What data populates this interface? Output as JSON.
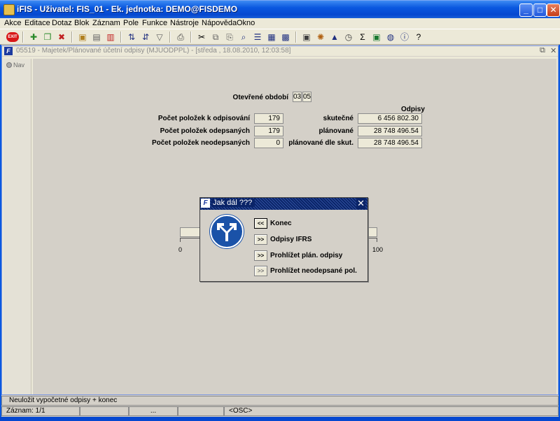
{
  "window": {
    "title": "iFIS - Uživatel: FIS_01 - Ek. jednotka: DEMO@FISDEMO"
  },
  "menu": [
    "Akce",
    "Editace",
    "Dotaz",
    "Blok",
    "Záznam",
    "Pole",
    "Funkce",
    "Nástroje",
    "Nápověda",
    "Okno"
  ],
  "toolbar": {
    "exit_label": "EXIT"
  },
  "child": {
    "title": "05519 - Majetek/Plánované účetní odpisy (MJUODPPL) - [středa , 18.08.2010, 12:03:58]"
  },
  "nav": {
    "label": "Nav"
  },
  "form": {
    "period_label": "Otevřené období",
    "period_month": "03",
    "period_num": "05",
    "odpisy_header": "Odpisy",
    "count_to_depreciate_label": "Počet položek k odpisování",
    "count_to_depreciate": "179",
    "count_depreciated_label": "Počet položek odepsaných",
    "count_depreciated": "179",
    "count_not_depreciated_label": "Počet položek neodepsaných",
    "count_not_depreciated": "0",
    "actual_label": "skutečné",
    "actual_value": "6 456 802.30",
    "planned_label": "plánované",
    "planned_value": "28 748 496.54",
    "planned_by_actual_label": "plánované dle skut.",
    "planned_by_actual_value": "28 748 496.54",
    "progress_min": "0",
    "progress_max": "100"
  },
  "dialog": {
    "title": "Jak dál ???",
    "options": [
      {
        "button": "<<",
        "label": "Konec"
      },
      {
        "button": ">>",
        "label": "Odpisy IFRS"
      },
      {
        "button": ">>",
        "label": "Prohlížet plán. odpisy"
      },
      {
        "button": ">>",
        "label": "Prohlížet neodepsané pol."
      }
    ]
  },
  "status": {
    "hint": "Neuložit vypočetné odpisy + konec",
    "record": "Záznam: 1/1",
    "cell3": "...",
    "osc": "<OSC>"
  }
}
